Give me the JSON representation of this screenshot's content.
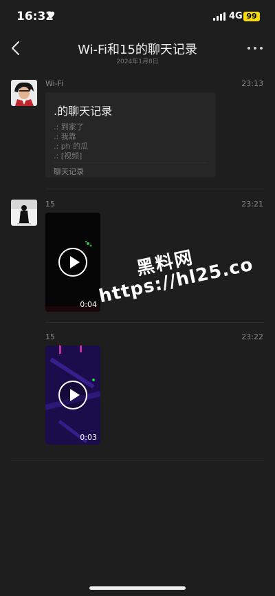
{
  "status_bar": {
    "time": "16:32",
    "network": "4G",
    "battery": "99"
  },
  "nav": {
    "title": "Wi-Fi和15的聊天记录",
    "subtitle": "2024年1月8日"
  },
  "messages": [
    {
      "sender": "Wi-Fi",
      "time": "23:13",
      "record": {
        "title": ".的聊天记录",
        "lines": [
          ".: 到家了",
          ".: 我靠",
          ".: ph 的瓜",
          ".: [视频]"
        ],
        "footer": "聊天记录"
      }
    },
    {
      "sender": "15",
      "time": "23:21",
      "video": {
        "duration": "0:04"
      }
    },
    {
      "sender": "15",
      "time": "23:22",
      "video": {
        "duration": "0:03"
      }
    }
  ],
  "watermark": {
    "line1": "黑料网",
    "line2": "https://hl25.co"
  }
}
